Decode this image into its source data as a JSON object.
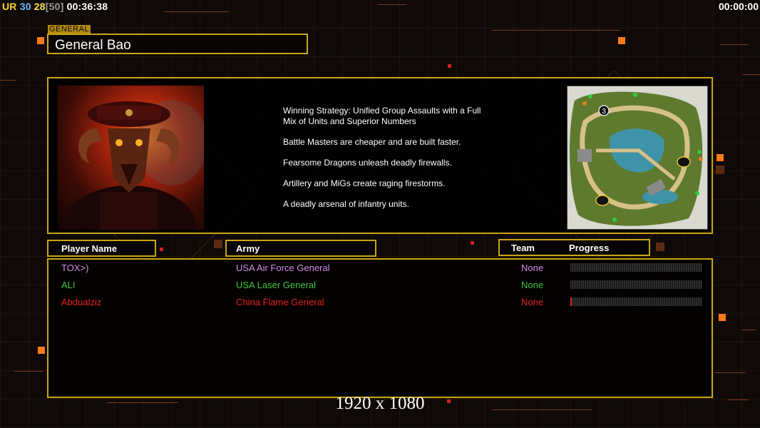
{
  "hud": {
    "ur": "UR",
    "num1": "30",
    "num2": "28",
    "num3": "[50]",
    "elapsed": "00:36:38",
    "timer": "00:00:00"
  },
  "general": {
    "section_label": "GENERAL",
    "name": "General Bao"
  },
  "strategy": {
    "lines": [
      "Winning Strategy: Unified Group Assaults with a Full\n Mix of Units and Superior Numbers",
      "Battle Masters are cheaper and are built faster.",
      "Fearsome Dragons unleash deadly firewalls.",
      "Artillery and MiGs create raging firestorms.",
      "A deadly arsenal of infantry units."
    ]
  },
  "table": {
    "col_player": "Player Name",
    "col_army": "Army",
    "col_team": "Team",
    "col_progress": "Progress"
  },
  "players": [
    {
      "name": "TOX>)",
      "army": "USA Air Force General",
      "team": "None",
      "progress": 0,
      "color": "#d68ce8"
    },
    {
      "name": "ALI",
      "army": "USA Laser General",
      "team": "None",
      "progress": 0,
      "color": "#3cc63c"
    },
    {
      "name": "Abdualziz",
      "army": "China Flame General",
      "team": "None",
      "progress": 0.01,
      "color": "#e8201e"
    }
  ],
  "map": {
    "marker_label": "3"
  },
  "resolution_label": "1920 x 1080"
}
